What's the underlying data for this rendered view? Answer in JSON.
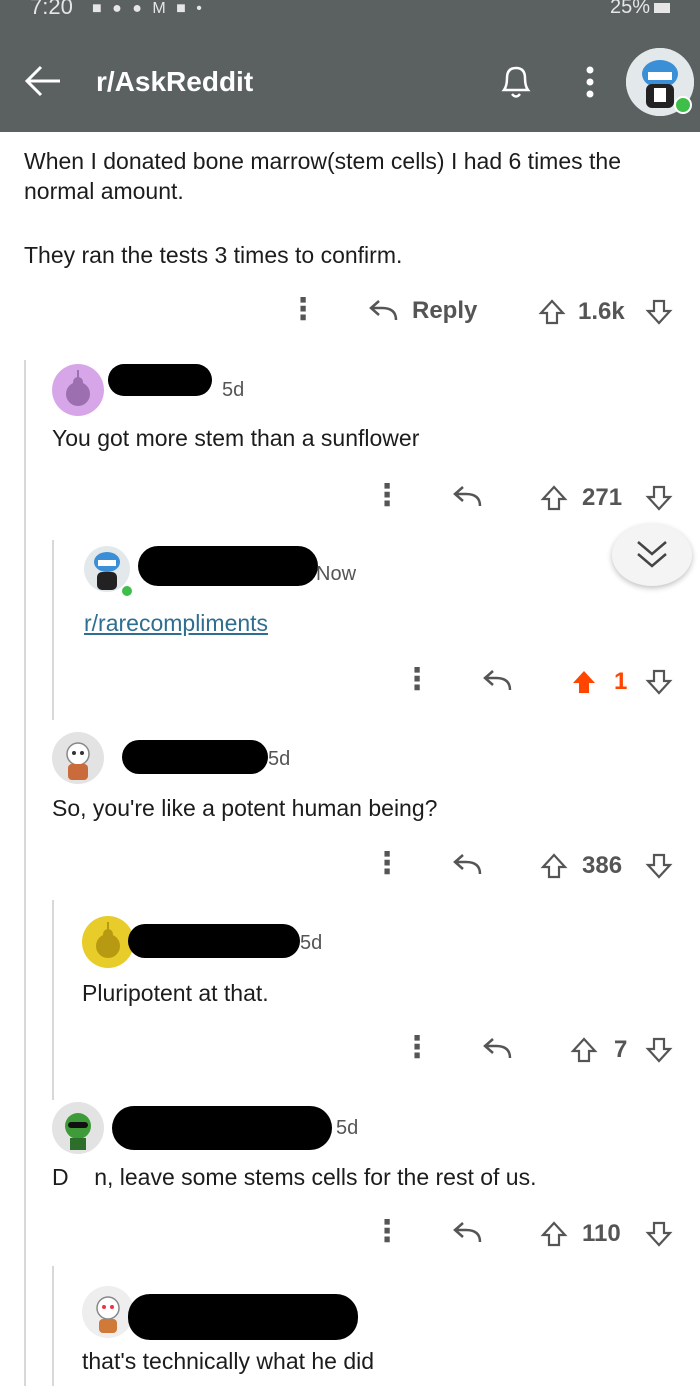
{
  "status_bar": {
    "time": "7:20",
    "battery": "25%"
  },
  "header": {
    "title": "r/AskReddit"
  },
  "top_comment": {
    "paragraph1": "When I donated bone marrow(stem cells) I had 6 times the normal amount.",
    "paragraph2": "They ran the tests 3 times to confirm.",
    "reply_label": "Reply",
    "votes": "1.6k"
  },
  "comments": [
    {
      "age": "5d",
      "body": "You got more stem than a sunflower",
      "votes": "271"
    },
    {
      "age": "Now",
      "body": "r/rarecompliments",
      "votes": "1"
    },
    {
      "age": "5d",
      "body": "So, you're like a potent human being?",
      "votes": "386"
    },
    {
      "age": "5d",
      "body": "Pluripotent at that.",
      "votes": "7"
    },
    {
      "age": "5d",
      "body": "D  n, leave some stems cells for the rest of us.",
      "votes": "110"
    },
    {
      "age": "",
      "body": "that's technically what he did",
      "votes": ""
    }
  ],
  "colors": {
    "header_bg": "#5b6060",
    "upvoted": "#ff4500",
    "link": "#2f6e90"
  }
}
